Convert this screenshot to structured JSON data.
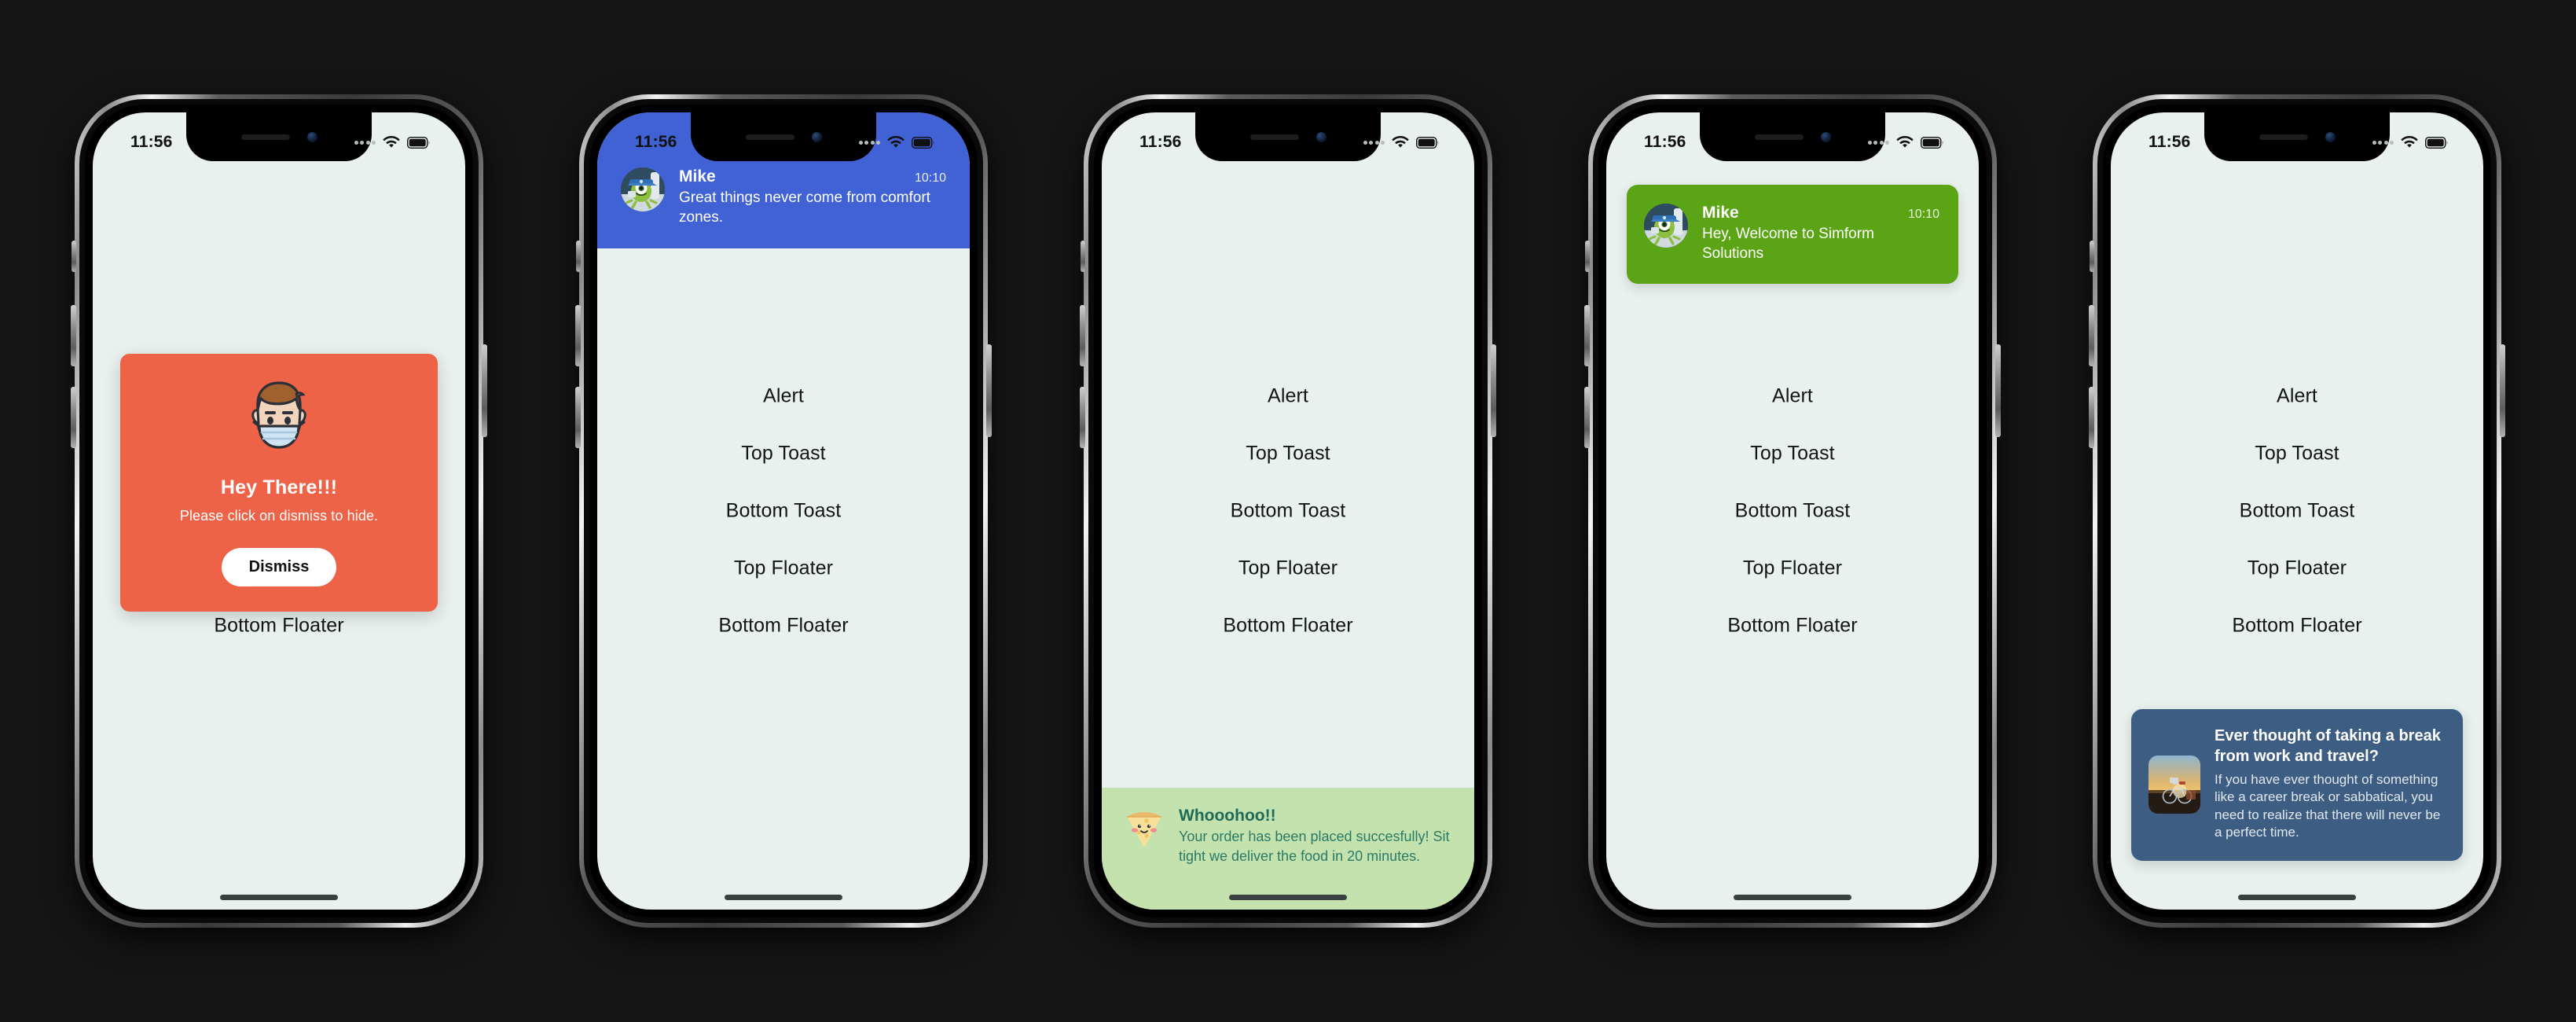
{
  "theme": {
    "page_background": "#151515",
    "screen_background": "#e9f1ef",
    "alert_card": "#ee6247",
    "top_toast": "#4162d4",
    "bottom_toast": "#c4e2ad",
    "top_floater": "#5ba416",
    "bottom_floater": "#3d5e82"
  },
  "status_bar": {
    "time": "11:56",
    "signal_icon": "signal-dots-icon",
    "wifi_icon": "wifi-icon",
    "battery_icon": "battery-icon"
  },
  "action_list": {
    "items": [
      {
        "label": "Alert"
      },
      {
        "label": "Top Toast"
      },
      {
        "label": "Bottom Toast"
      },
      {
        "label": "Top Floater"
      },
      {
        "label": "Bottom Floater"
      }
    ]
  },
  "phones": [
    {
      "id": "phone-alert",
      "variant": "alert",
      "alert": {
        "avatar_icon": "masked-man-avatar-icon",
        "title": "Hey There!!!",
        "subtitle": "Please click on dismiss to hide.",
        "button_label": "Dismiss"
      }
    },
    {
      "id": "phone-top-toast",
      "variant": "top-toast",
      "toast": {
        "avatar_icon": "mike-avatar-icon",
        "name": "Mike",
        "time": "10:10",
        "message": "Great things never come from comfort zones."
      }
    },
    {
      "id": "phone-bottom-toast",
      "variant": "bottom-toast",
      "toast": {
        "avatar_icon": "pizza-slice-icon",
        "title": "Whooohoo!!",
        "message": "Your order has been placed succesfully! Sit tight we deliver the food in 20 minutes."
      }
    },
    {
      "id": "phone-top-floater",
      "variant": "top-floater",
      "floater": {
        "avatar_icon": "mike-avatar-icon",
        "name": "Mike",
        "time": "10:10",
        "message": "Hey, Welcome to Simform Solutions"
      }
    },
    {
      "id": "phone-bottom-floater",
      "variant": "bottom-floater",
      "floater": {
        "thumbnail_icon": "sunset-bicycle-thumbnail-icon",
        "title": "Ever thought of taking a break from work and travel?",
        "message": "If you have ever thought of something like a career break or sabbatical, you need to realize that there will never be a perfect time."
      }
    }
  ]
}
